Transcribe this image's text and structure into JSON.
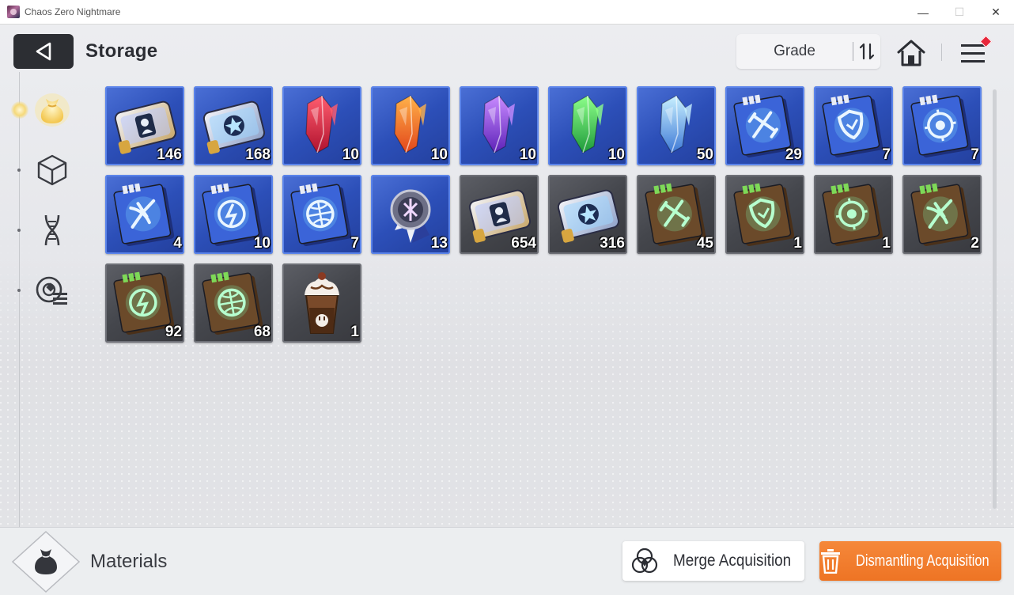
{
  "window": {
    "title": "Chaos Zero Nightmare",
    "controls": [
      "—",
      "☐",
      "✕"
    ]
  },
  "header": {
    "title": "Storage",
    "sort_label": "Grade",
    "sort_icon": "sort-toggle-icon",
    "home_icon": "home-icon",
    "menu_icon": "hamburger-menu-icon",
    "menu_has_notification": true
  },
  "sidebar": {
    "items": [
      {
        "icon": "pouch-icon",
        "active": true
      },
      {
        "icon": "cube-icon",
        "active": false
      },
      {
        "icon": "dna-icon",
        "active": false
      },
      {
        "icon": "target-list-icon",
        "active": false
      }
    ]
  },
  "inventory": {
    "items": [
      {
        "icon": "gold-ticket-icon",
        "rarity": "blue",
        "count": "146"
      },
      {
        "icon": "star-ticket-icon",
        "rarity": "blue",
        "count": "168"
      },
      {
        "icon": "red-crystal-icon",
        "rarity": "blue",
        "count": "10"
      },
      {
        "icon": "orange-crystal-icon",
        "rarity": "blue",
        "count": "10"
      },
      {
        "icon": "purple-crystal-icon",
        "rarity": "blue",
        "count": "10"
      },
      {
        "icon": "green-crystal-icon",
        "rarity": "blue",
        "count": "10"
      },
      {
        "icon": "blue-crystal-icon",
        "rarity": "blue",
        "count": "50"
      },
      {
        "icon": "sword-book-icon",
        "rarity": "blue",
        "count": "29"
      },
      {
        "icon": "shield-book-icon",
        "rarity": "blue",
        "count": "7"
      },
      {
        "icon": "eye-book-icon",
        "rarity": "blue",
        "count": "7"
      },
      {
        "icon": "wing-book-icon",
        "rarity": "blue",
        "count": "4"
      },
      {
        "icon": "bolt-book-icon",
        "rarity": "blue",
        "count": "10"
      },
      {
        "icon": "globe-book-icon",
        "rarity": "blue",
        "count": "7"
      },
      {
        "icon": "medal-icon",
        "rarity": "blue",
        "count": "13"
      },
      {
        "icon": "gold-ticket-icon",
        "rarity": "grey",
        "count": "654"
      },
      {
        "icon": "star-ticket-icon",
        "rarity": "grey",
        "count": "316"
      },
      {
        "icon": "sword-tome-icon",
        "rarity": "grey",
        "count": "45"
      },
      {
        "icon": "shield-tome-icon",
        "rarity": "grey",
        "count": "1"
      },
      {
        "icon": "eye-tome-icon",
        "rarity": "grey",
        "count": "1"
      },
      {
        "icon": "wing-tome-icon",
        "rarity": "grey",
        "count": "2"
      },
      {
        "icon": "bolt-tome-icon",
        "rarity": "grey",
        "count": "92"
      },
      {
        "icon": "globe-tome-icon",
        "rarity": "grey",
        "count": "68"
      },
      {
        "icon": "frappe-icon",
        "rarity": "grey",
        "count": "1"
      }
    ]
  },
  "footer": {
    "category_icon": "material-bag-icon",
    "category_label": "Materials",
    "merge_label": "Merge Acquisition",
    "merge_icon": "merge-circles-icon",
    "dismantle_label": "Dismantling Acquisition",
    "dismantle_icon": "trash-icon"
  },
  "colors": {
    "accent_orange": "#ee7424",
    "rarity_blue": "#2c4fb8",
    "rarity_grey": "#44464c",
    "notification_red": "#e8263a"
  }
}
